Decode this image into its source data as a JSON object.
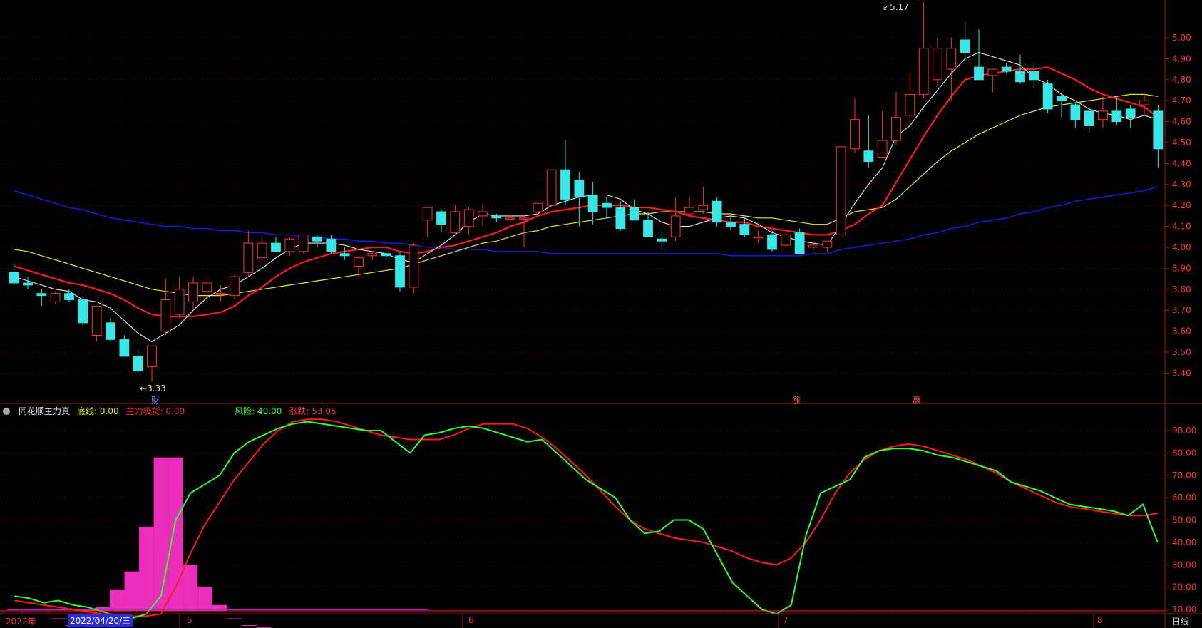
{
  "colors": {
    "up": "#ff3333",
    "down": "#39e6e6",
    "ma5": "#e8e8e8",
    "ma10": "#ff1a1a",
    "ma20": "#e6e62e",
    "ma60": "#1a1adc",
    "vol": "#ff33cc",
    "green_line": "#2cff2c",
    "red_line": "#ff1a1a",
    "axis": "#aa1111",
    "grid": "#6a0000"
  },
  "indicator": {
    "name": "同花顺主力真",
    "bottom_line": "底线: 0.00",
    "main_absorb": "主力吸货: 0.00",
    "risk": "风险: 40.00",
    "rise_fall": "涨跌: 53.05"
  },
  "bottom": {
    "year": "2022年",
    "date": "2022/04/20/三",
    "months": [
      "5",
      "6",
      "7",
      "8"
    ],
    "period": "日线"
  },
  "markers": {
    "high_label": "5.17",
    "low_label": "3.33",
    "cai": "财",
    "zhang": "涨",
    "ying": "赢"
  },
  "chart_data": [
    {
      "type": "candlestick",
      "ylim": [
        3.33,
        5.17
      ],
      "y_ticks": [
        3.4,
        3.5,
        3.6,
        3.7,
        3.8,
        3.9,
        4.0,
        4.1,
        4.2,
        4.3,
        4.4,
        4.5,
        4.6,
        4.7,
        4.8,
        4.9,
        5.0
      ],
      "y_tick_labels": [
        "3.40",
        "3.50",
        "3.60",
        "3.70",
        "3.80",
        "3.90",
        "4.00",
        "4.10",
        "4.20",
        "4.30",
        "4.40",
        "4.50",
        "4.60",
        "4.70",
        "4.80",
        "4.90",
        "5.00"
      ],
      "ohlc": [
        [
          3.88,
          3.92,
          3.82,
          3.83
        ],
        [
          3.83,
          3.86,
          3.8,
          3.82
        ],
        [
          3.78,
          3.8,
          3.72,
          3.77
        ],
        [
          3.74,
          3.79,
          3.73,
          3.78
        ],
        [
          3.78,
          3.8,
          3.74,
          3.75
        ],
        [
          3.75,
          3.77,
          3.62,
          3.64
        ],
        [
          3.58,
          3.72,
          3.55,
          3.72
        ],
        [
          3.64,
          3.66,
          3.55,
          3.56
        ],
        [
          3.56,
          3.58,
          3.48,
          3.48
        ],
        [
          3.48,
          3.51,
          3.4,
          3.41
        ],
        [
          3.43,
          3.52,
          3.36,
          3.53
        ],
        [
          3.6,
          3.85,
          3.58,
          3.75
        ],
        [
          3.68,
          3.86,
          3.66,
          3.8
        ],
        [
          3.74,
          3.86,
          3.7,
          3.83
        ],
        [
          3.79,
          3.86,
          3.75,
          3.83
        ],
        [
          3.78,
          3.82,
          3.74,
          3.78
        ],
        [
          3.77,
          3.87,
          3.75,
          3.86
        ],
        [
          3.88,
          4.08,
          3.86,
          4.02
        ],
        [
          3.95,
          4.06,
          3.92,
          4.02
        ],
        [
          4.02,
          4.05,
          3.99,
          3.98
        ],
        [
          3.98,
          4.05,
          3.96,
          4.04
        ],
        [
          3.98,
          4.06,
          3.97,
          4.06
        ],
        [
          4.05,
          4.06,
          4.0,
          4.03
        ],
        [
          4.04,
          4.06,
          3.97,
          3.98
        ],
        [
          3.97,
          4.0,
          3.94,
          3.96
        ],
        [
          3.91,
          3.96,
          3.86,
          3.95
        ],
        [
          3.96,
          3.98,
          3.94,
          3.97
        ],
        [
          3.97,
          3.99,
          3.94,
          3.96
        ],
        [
          3.96,
          3.98,
          3.79,
          3.81
        ],
        [
          3.81,
          4.02,
          3.78,
          4.01
        ],
        [
          4.13,
          4.19,
          4.05,
          4.19
        ],
        [
          4.17,
          4.18,
          4.07,
          4.11
        ],
        [
          4.07,
          4.2,
          4.06,
          4.17
        ],
        [
          4.1,
          4.19,
          4.06,
          4.18
        ],
        [
          4.15,
          4.2,
          4.1,
          4.17
        ],
        [
          4.15,
          4.16,
          4.12,
          4.14
        ],
        [
          4.14,
          4.16,
          4.1,
          4.14
        ],
        [
          4.14,
          4.15,
          4.0,
          4.14
        ],
        [
          4.17,
          4.22,
          4.16,
          4.21
        ],
        [
          4.2,
          4.36,
          4.19,
          4.37
        ],
        [
          4.37,
          4.51,
          4.2,
          4.23
        ],
        [
          4.32,
          4.36,
          4.1,
          4.24
        ],
        [
          4.25,
          4.31,
          4.11,
          4.17
        ],
        [
          4.21,
          4.24,
          4.14,
          4.19
        ],
        [
          4.19,
          4.22,
          4.08,
          4.09
        ],
        [
          4.19,
          4.23,
          4.13,
          4.13
        ],
        [
          4.13,
          4.17,
          4.05,
          4.05
        ],
        [
          4.04,
          4.08,
          3.99,
          4.03
        ],
        [
          4.05,
          4.24,
          4.03,
          4.15
        ],
        [
          4.16,
          4.24,
          4.15,
          4.19
        ],
        [
          4.18,
          4.29,
          4.16,
          4.2
        ],
        [
          4.22,
          4.24,
          4.1,
          4.12
        ],
        [
          4.12,
          4.15,
          4.08,
          4.1
        ],
        [
          4.11,
          4.14,
          4.05,
          4.06
        ],
        [
          4.05,
          4.08,
          4.02,
          4.05
        ],
        [
          4.06,
          4.08,
          3.98,
          3.99
        ],
        [
          4.01,
          4.07,
          3.99,
          4.06
        ],
        [
          4.07,
          4.09,
          3.97,
          3.97
        ],
        [
          4.0,
          4.02,
          3.99,
          4.01
        ],
        [
          4.0,
          4.02,
          3.98,
          4.03
        ],
        [
          4.06,
          4.48,
          4.05,
          4.48
        ],
        [
          4.47,
          4.71,
          4.45,
          4.61
        ],
        [
          4.46,
          4.63,
          4.38,
          4.41
        ],
        [
          4.43,
          4.65,
          4.43,
          4.51
        ],
        [
          4.51,
          4.74,
          4.49,
          4.62
        ],
        [
          4.63,
          4.84,
          4.58,
          4.73
        ],
        [
          4.73,
          5.17,
          4.71,
          4.95
        ],
        [
          4.8,
          5.0,
          4.77,
          4.95
        ],
        [
          4.85,
          5.0,
          4.7,
          4.95
        ],
        [
          4.99,
          5.08,
          4.89,
          4.93
        ],
        [
          4.86,
          5.04,
          4.83,
          4.8
        ],
        [
          4.82,
          4.85,
          4.74,
          4.85
        ],
        [
          4.86,
          4.88,
          4.83,
          4.84
        ],
        [
          4.84,
          4.92,
          4.78,
          4.79
        ],
        [
          4.84,
          4.88,
          4.76,
          4.8
        ],
        [
          4.78,
          4.8,
          4.64,
          4.66
        ],
        [
          4.72,
          4.74,
          4.62,
          4.7
        ],
        [
          4.68,
          4.69,
          4.57,
          4.61
        ],
        [
          4.65,
          4.64,
          4.55,
          4.58
        ],
        [
          4.61,
          4.72,
          4.57,
          4.65
        ],
        [
          4.65,
          4.72,
          4.58,
          4.6
        ],
        [
          4.66,
          4.68,
          4.57,
          4.62
        ],
        [
          4.68,
          4.74,
          4.63,
          4.7
        ],
        [
          4.65,
          4.68,
          4.38,
          4.47
        ]
      ],
      "ma5": [
        3.86,
        3.84,
        3.82,
        3.8,
        3.79,
        3.75,
        3.74,
        3.71,
        3.65,
        3.59,
        3.55,
        3.59,
        3.63,
        3.7,
        3.76,
        3.8,
        3.82,
        3.86,
        3.9,
        3.95,
        3.99,
        4.02,
        4.02,
        4.02,
        4.01,
        3.99,
        3.98,
        3.97,
        3.94,
        3.93,
        3.97,
        4.01,
        4.06,
        4.12,
        4.16,
        4.15,
        4.15,
        4.15,
        4.16,
        4.2,
        4.22,
        4.24,
        4.25,
        4.25,
        4.23,
        4.18,
        4.16,
        4.12,
        4.1,
        4.1,
        4.12,
        4.14,
        4.15,
        4.14,
        4.11,
        4.07,
        4.05,
        4.03,
        4.02,
        4.01,
        4.11,
        4.21,
        4.3,
        4.38,
        4.53,
        4.58,
        4.67,
        4.75,
        4.83,
        4.9,
        4.93,
        4.91,
        4.89,
        4.87,
        4.81,
        4.78,
        4.73,
        4.7,
        4.66,
        4.64,
        4.63,
        4.61,
        4.63,
        4.61
      ],
      "ma10": [
        3.91,
        3.89,
        3.87,
        3.85,
        3.83,
        3.82,
        3.8,
        3.78,
        3.75,
        3.71,
        3.68,
        3.67,
        3.67,
        3.67,
        3.68,
        3.69,
        3.72,
        3.77,
        3.81,
        3.86,
        3.9,
        3.93,
        3.95,
        3.97,
        3.98,
        3.99,
        4.0,
        4.0,
        3.98,
        3.97,
        3.98,
        4.0,
        4.01,
        4.03,
        4.05,
        4.07,
        4.1,
        4.12,
        4.15,
        4.17,
        4.18,
        4.19,
        4.2,
        4.2,
        4.2,
        4.19,
        4.19,
        4.18,
        4.17,
        4.15,
        4.14,
        4.13,
        4.12,
        4.12,
        4.1,
        4.09,
        4.08,
        4.07,
        4.06,
        4.06,
        4.08,
        4.11,
        4.16,
        4.2,
        4.31,
        4.42,
        4.53,
        4.63,
        4.72,
        4.8,
        4.82,
        4.83,
        4.84,
        4.85,
        4.85,
        4.86,
        4.83,
        4.8,
        4.76,
        4.73,
        4.71,
        4.69,
        4.67,
        4.62
      ],
      "ma20": [
        3.99,
        3.98,
        3.96,
        3.94,
        3.92,
        3.9,
        3.88,
        3.86,
        3.84,
        3.82,
        3.8,
        3.79,
        3.78,
        3.77,
        3.77,
        3.77,
        3.78,
        3.79,
        3.8,
        3.81,
        3.82,
        3.83,
        3.84,
        3.85,
        3.86,
        3.87,
        3.88,
        3.89,
        3.9,
        3.92,
        3.94,
        3.96,
        3.98,
        4.0,
        4.02,
        4.03,
        4.05,
        4.07,
        4.08,
        4.1,
        4.11,
        4.12,
        4.13,
        4.14,
        4.15,
        4.16,
        4.16,
        4.17,
        4.17,
        4.17,
        4.17,
        4.16,
        4.16,
        4.15,
        4.14,
        4.14,
        4.13,
        4.12,
        4.11,
        4.11,
        4.14,
        4.17,
        4.18,
        4.19,
        4.23,
        4.29,
        4.35,
        4.41,
        4.46,
        4.5,
        4.54,
        4.57,
        4.6,
        4.63,
        4.65,
        4.67,
        4.68,
        4.69,
        4.7,
        4.71,
        4.72,
        4.73,
        4.73,
        4.72
      ],
      "ma60": [
        4.27,
        4.25,
        4.23,
        4.21,
        4.19,
        4.18,
        4.16,
        4.14,
        4.13,
        4.12,
        4.11,
        4.1,
        4.1,
        4.09,
        4.09,
        4.08,
        4.08,
        4.07,
        4.07,
        4.06,
        4.06,
        4.05,
        4.05,
        4.04,
        4.04,
        4.03,
        4.03,
        4.02,
        4.02,
        4.01,
        4.0,
        4.0,
        3.99,
        3.99,
        3.99,
        3.98,
        3.98,
        3.98,
        3.98,
        3.97,
        3.97,
        3.97,
        3.97,
        3.97,
        3.97,
        3.97,
        3.97,
        3.97,
        3.97,
        3.97,
        3.97,
        3.97,
        3.96,
        3.96,
        3.96,
        3.96,
        3.96,
        3.96,
        3.97,
        3.97,
        3.99,
        4.0,
        4.01,
        4.02,
        4.03,
        4.04,
        4.06,
        4.07,
        4.09,
        4.1,
        4.12,
        4.13,
        4.14,
        4.16,
        4.17,
        4.19,
        4.2,
        4.22,
        4.23,
        4.24,
        4.25,
        4.26,
        4.27,
        4.29
      ]
    },
    {
      "type": "line",
      "ylim": [
        0,
        100
      ],
      "y_ticks": [
        10,
        20,
        30,
        40,
        50,
        60,
        70,
        80,
        90
      ],
      "y_tick_labels": [
        "10.00",
        "20.00",
        "30.00",
        "40.00",
        "50.00",
        "60.00",
        "70.00",
        "80.00",
        "90.00"
      ],
      "green": [
        16,
        15,
        13,
        14,
        12,
        11,
        9,
        7,
        6,
        8,
        16,
        50,
        62,
        66,
        70,
        80,
        85,
        88,
        91,
        93,
        94,
        93,
        92,
        91,
        90,
        90,
        85,
        80,
        88,
        89,
        91,
        92,
        91,
        89,
        87,
        85,
        86,
        80,
        74,
        68,
        64,
        60,
        50,
        44,
        45,
        50,
        50,
        46,
        34,
        22,
        16,
        10,
        8,
        12,
        43,
        62,
        65,
        68,
        78,
        81,
        82,
        82,
        81,
        79,
        78,
        76,
        74,
        72,
        67,
        65,
        63,
        60,
        57,
        56,
        55,
        54,
        52,
        57,
        40
      ],
      "red": [
        14,
        13,
        12,
        11,
        10,
        9,
        8,
        7,
        7,
        7,
        8,
        20,
        35,
        48,
        58,
        68,
        76,
        84,
        90,
        94,
        95,
        95,
        94,
        92,
        90,
        88,
        87,
        86,
        86,
        86,
        88,
        91,
        93,
        93,
        93,
        91,
        87,
        82,
        76,
        70,
        63,
        56,
        50,
        46,
        44,
        42,
        41,
        40,
        38,
        36,
        33,
        31,
        30,
        33,
        40,
        50,
        62,
        71,
        77,
        81,
        83,
        84,
        83,
        81,
        79,
        77,
        74,
        71,
        67,
        64,
        61,
        58,
        56,
        55,
        54,
        53,
        52,
        52,
        53
      ],
      "bars": [
        0,
        9,
        9,
        6,
        3,
        10,
        11,
        19,
        27,
        47,
        78,
        78,
        30,
        20,
        12,
        6,
        3,
        2,
        1.5,
        1,
        0.8,
        0.6,
        0.4,
        0.3,
        0.2,
        0.1,
        0.05,
        0,
        0,
        0,
        0,
        0,
        0,
        0,
        0,
        0,
        0,
        0,
        0,
        0,
        0,
        0,
        0,
        0,
        0,
        0,
        0,
        0,
        0,
        0,
        0,
        0,
        0,
        0,
        0,
        0,
        0,
        0,
        0,
        0,
        0,
        0,
        0,
        0,
        0,
        0,
        0,
        0,
        0,
        0,
        0,
        0,
        0,
        0,
        0,
        0,
        0,
        0,
        0
      ]
    }
  ]
}
